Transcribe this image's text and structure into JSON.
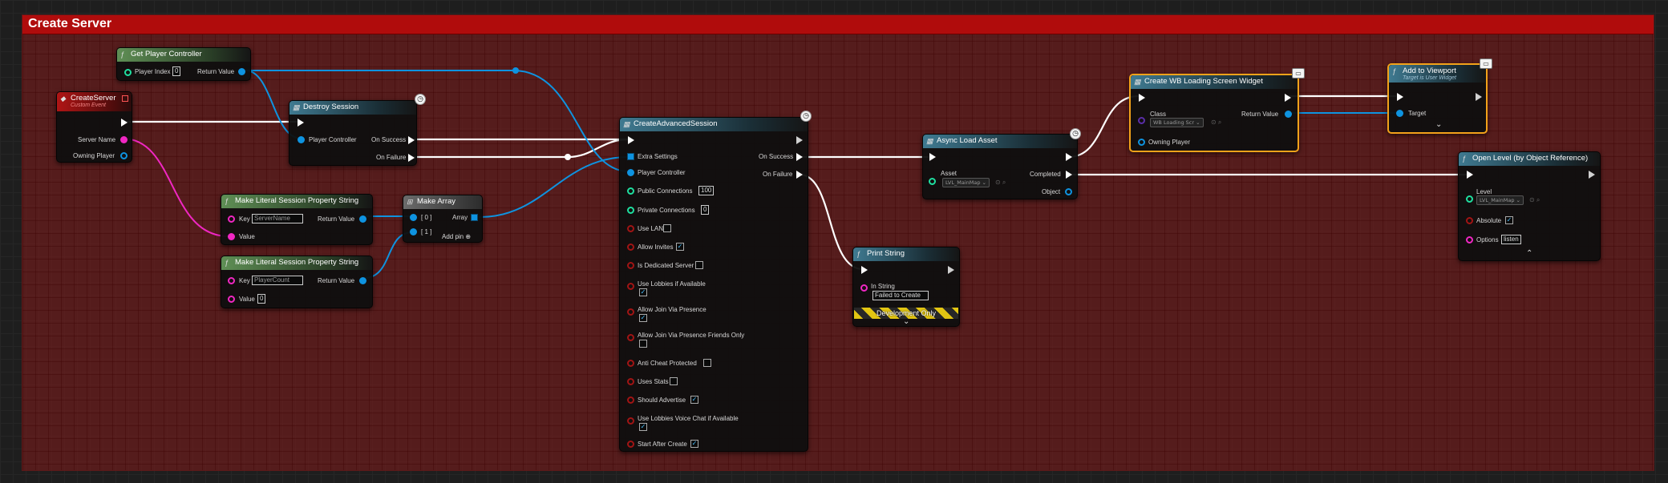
{
  "comment": {
    "title": "Create Server"
  },
  "nodes": {
    "get_pc": {
      "title": "Get Player Controller",
      "player_index_label": "Player Index",
      "player_index": "0",
      "return_label": "Return Value"
    },
    "create_server": {
      "title": "CreateServer",
      "subtitle": "Custom Event",
      "server_name": "Server Name",
      "owning_player": "Owning Player"
    },
    "destroy": {
      "title": "Destroy Session",
      "player_controller": "Player Controller",
      "on_success": "On Success",
      "on_failure": "On Failure"
    },
    "literal1": {
      "title": "Make Literal Session Property String",
      "key_label": "Key",
      "key": "ServerName",
      "value_label": "Value",
      "return_label": "Return Value"
    },
    "literal2": {
      "title": "Make Literal Session Property String",
      "key_label": "Key",
      "key": "PlayerCount",
      "value_label": "Value",
      "value": "0",
      "return_label": "Return Value"
    },
    "make_array": {
      "title": "Make Array",
      "in0": "[ 0 ]",
      "in1": "[ 1 ]",
      "array_label": "Array",
      "add_pin": "Add pin"
    },
    "cas": {
      "title": "CreateAdvancedSession",
      "extra": "Extra Settings",
      "pc": "Player Controller",
      "pub": "Public Connections",
      "pub_val": "100",
      "priv": "Private Connections",
      "priv_val": "0",
      "lan": "Use LAN",
      "invites": "Allow Invites",
      "dedicated": "Is Dedicated Server",
      "lobbies": "Use Lobbies if Available",
      "presence": "Allow Join Via Presence",
      "presence_friends": "Allow Join Via Presence Friends Only",
      "anticheat": "Anti Cheat Protected",
      "stats": "Uses Stats",
      "advertise": "Should Advertise",
      "voice": "Use Lobbies Voice Chat if Available",
      "start": "Start After Create",
      "on_success": "On Success",
      "on_failure": "On Failure"
    },
    "print": {
      "title": "Print String",
      "in_label": "In String",
      "in_val": "Failed to Create",
      "dev": "Development Only"
    },
    "async": {
      "title": "Async Load Asset",
      "asset_label": "Asset",
      "asset_val": "LVL_MainMap",
      "completed": "Completed",
      "object": "Object"
    },
    "create_widget": {
      "title": "Create WB Loading Screen Widget",
      "class_label": "Class",
      "class_val": "WB Loading Scr",
      "owning_player": "Owning Player",
      "return_label": "Return Value"
    },
    "add_viewport": {
      "title": "Add to Viewport",
      "subtitle": "Target is User Widget",
      "target": "Target"
    },
    "open_level": {
      "title": "Open Level (by Object Reference)",
      "level_label": "Level",
      "level_val": "LVL_MainMap",
      "absolute": "Absolute",
      "options_label": "Options",
      "options_val": "listen"
    }
  },
  "check": "✓",
  "colors": {
    "exec": "#ffffff",
    "object": "#0e93e0",
    "string": "#f027c3",
    "comment": "#b00c0c",
    "selection": "#f3a21a"
  }
}
